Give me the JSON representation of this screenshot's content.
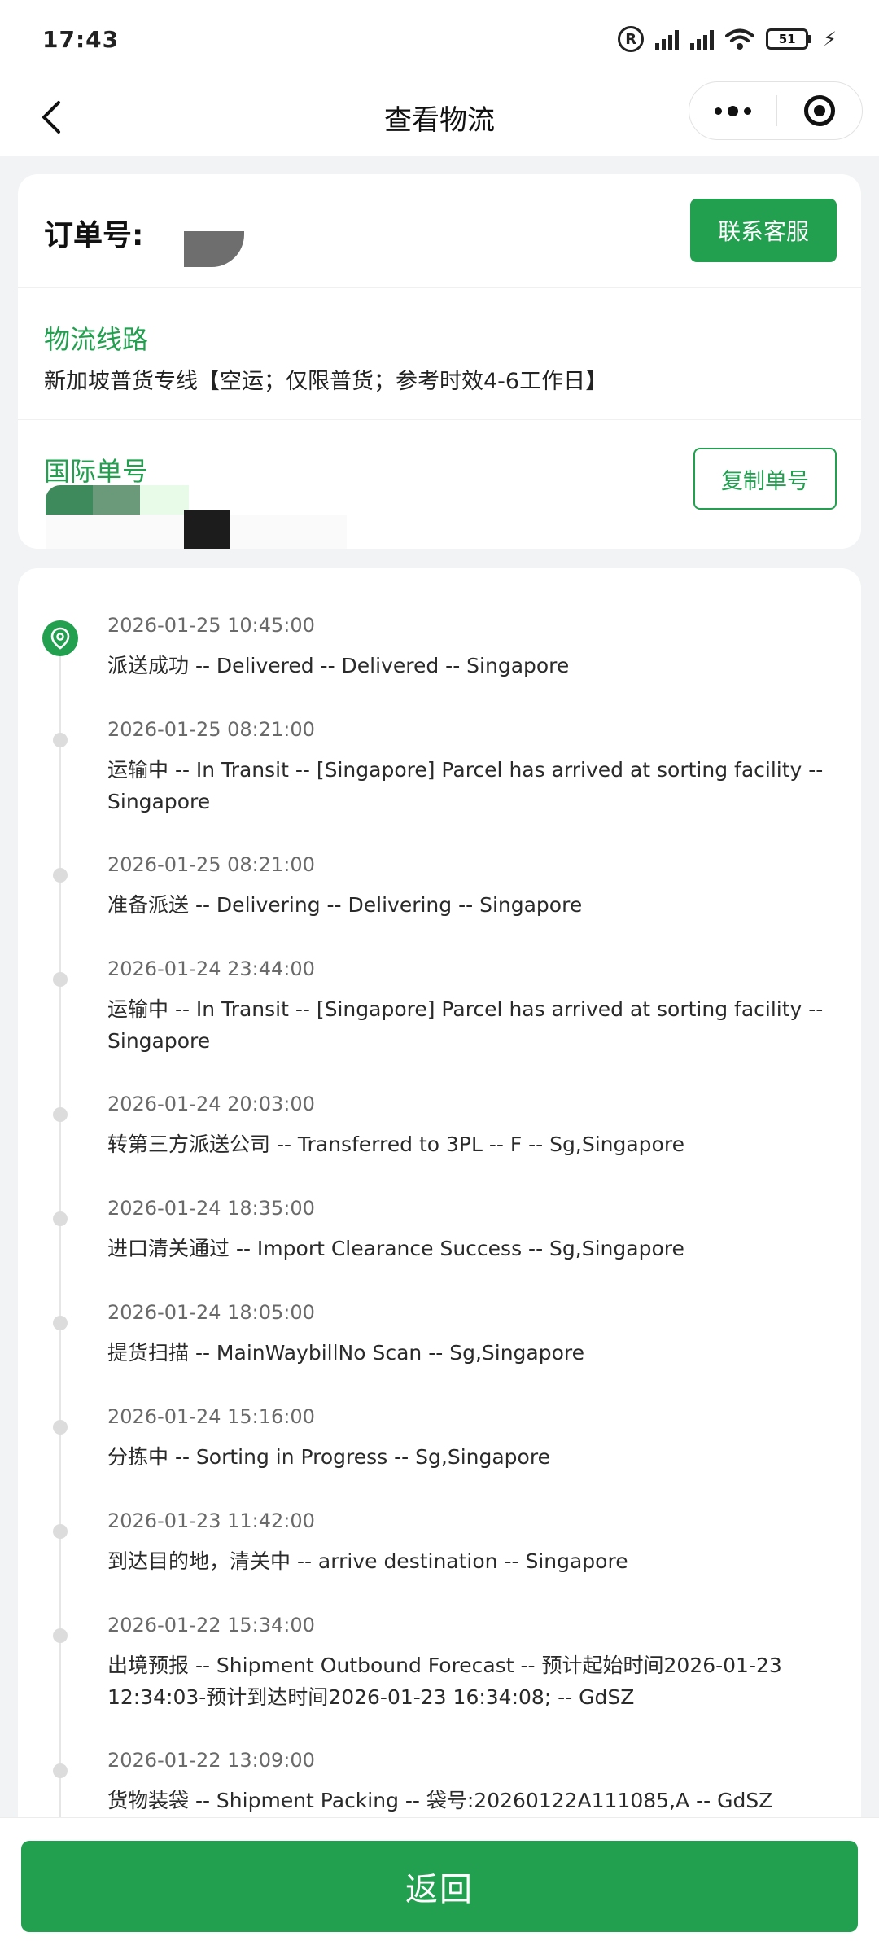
{
  "status_bar": {
    "time": "17:43",
    "battery_level": "51",
    "registered_symbol": "R",
    "icons": [
      "registered-icon",
      "signal-icon",
      "signal-icon",
      "wifi-icon",
      "battery-icon",
      "charging-bolt-icon"
    ]
  },
  "nav": {
    "title": "查看物流",
    "icons": [
      "back-chevron-icon",
      "more-dots-icon",
      "close-target-icon"
    ]
  },
  "order": {
    "label": "订单号:",
    "contact_button": "联系客服"
  },
  "route": {
    "label": "物流线路",
    "value": "新加坡普货专线【空运；仅限普货；参考时效4-6工作日】"
  },
  "international": {
    "label": "国际单号",
    "copy_button": "复制单号"
  },
  "events": [
    {
      "time": "2026-01-25 10:45:00",
      "desc": "派送成功 -- Delivered -- Delivered -- Singapore",
      "current": true
    },
    {
      "time": "2026-01-25 08:21:00",
      "desc": "运输中 -- In Transit -- [Singapore] Parcel has arrived at sorting facility -- Singapore"
    },
    {
      "time": "2026-01-25 08:21:00",
      "desc": "准备派送 -- Delivering -- Delivering -- Singapore"
    },
    {
      "time": "2026-01-24 23:44:00",
      "desc": "运输中 -- In Transit -- [Singapore] Parcel has arrived at sorting facility -- Singapore"
    },
    {
      "time": "2026-01-24 20:03:00",
      "desc": "转第三方派送公司 -- Transferred to 3PL -- F -- Sg,Singapore"
    },
    {
      "time": "2026-01-24 18:35:00",
      "desc": "进口清关通过 -- Import Clearance Success -- Sg,Singapore"
    },
    {
      "time": "2026-01-24 18:05:00",
      "desc": "提货扫描 -- MainWaybillNo Scan -- Sg,Singapore"
    },
    {
      "time": "2026-01-24 15:16:00",
      "desc": "分拣中 -- Sorting in Progress -- Sg,Singapore"
    },
    {
      "time": "2026-01-23 11:42:00",
      "desc": "到达目的地，清关中 -- arrive destination -- Singapore"
    },
    {
      "time": "2026-01-22 15:34:00",
      "desc": "出境预报 -- Shipment Outbound Forecast -- 预计起始时间2026-01-23 12:34:03-预计到达时间2026-01-23 16:34:08; -- GdSZ"
    },
    {
      "time": "2026-01-22 13:09:00",
      "desc": "货物装袋 -- Shipment Packing -- 袋号:20260122A111085,A -- GdSZ"
    }
  ],
  "bottom": {
    "return_button": "返回"
  },
  "colors": {
    "accent": "#22a050",
    "background": "#f2f3f5",
    "timeline_dot": "#dcdcdc"
  }
}
